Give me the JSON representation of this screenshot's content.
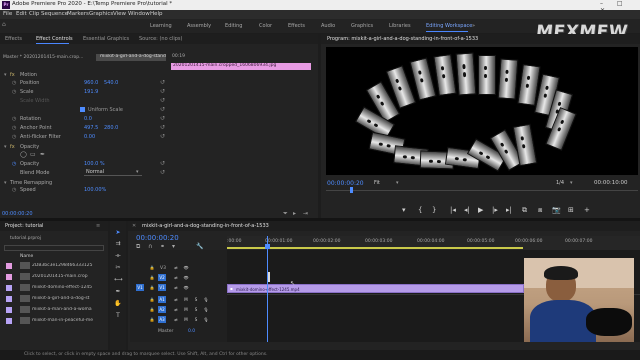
{
  "window": {
    "title": "Adobe Premiere Pro 2020 - E:\\Temp Premiere Pro\\tutorial *",
    "app_icon": "Pr",
    "controls": "–  □  ✕"
  },
  "menu": [
    "File",
    "Edit",
    "Clip",
    "Sequence",
    "Markers",
    "Graphics",
    "View",
    "Window",
    "Help"
  ],
  "workspaces": {
    "items": [
      "Learning",
      "Assembly",
      "Editing",
      "Color",
      "Effects",
      "Audio",
      "Graphics",
      "Libraries",
      "Editing Workspace"
    ],
    "active_index": 8,
    "more": "»"
  },
  "watermark": "MEXMEW",
  "left_tabs": [
    "Effects",
    "Effect Controls",
    "Essential Graphics",
    "Source: (no clips)"
  ],
  "left_tabs_active": 1,
  "effect_controls": {
    "master_label": "Master * 20201201415-main.crop...",
    "clip_label": "mixkit-a-girl-and-a-dog-standi...",
    "timecode_ruler": "00:19",
    "clip_bar": "20201201415-main.cropped_1606806934.jpg",
    "motion": "Motion",
    "position_label": "Position",
    "position_x": "960.0",
    "position_y": "540.0",
    "scale_label": "Scale",
    "scale_value": "191.9",
    "scale_width_label": "Scale Width",
    "uniform_scale": "Uniform Scale",
    "rotation_label": "Rotation",
    "rotation_value": "0.0",
    "anchor_label": "Anchor Point",
    "anchor_x": "497.5",
    "anchor_y": "280.0",
    "antiflicker_label": "Anti-flicker Filter",
    "antiflicker_value": "0.00",
    "opacity": "Opacity",
    "opacity_label": "Opacity",
    "opacity_value": "100.0 %",
    "blend_label": "Blend Mode",
    "blend_value": "Normal",
    "time_remap": "Time Remapping",
    "speed_label": "Speed",
    "speed_value": "100.00%",
    "bottom_timecode": "00:00:00:20"
  },
  "program": {
    "tab": "Program: mixkit-a-girl-and-a-dog-standing-in-front-of-a-1533",
    "timecode": "00:00:00:20",
    "fit": "Fit",
    "resolution": "1/4",
    "duration": "00:00:10:00",
    "controls": [
      "▾",
      "{",
      "}",
      "|◂",
      "◂|",
      "▶",
      "|▸",
      "▸|",
      "⧉",
      "⧈",
      "📷",
      "⊞",
      "+"
    ]
  },
  "project": {
    "tab": "Project: tutorial",
    "file": "tutorial.prproj",
    "name_header": "Name",
    "items": [
      {
        "name": "2DB3bc3e1298466333125",
        "color": "#e39be0"
      },
      {
        "name": "20201201415-main.crop",
        "color": "#e39be0"
      },
      {
        "name": "mixkit-domino-effect-1245",
        "color": "#b7a3f5"
      },
      {
        "name": "mixkit-a-girl-and-a-dog-st",
        "color": "#b7a3f5"
      },
      {
        "name": "mixkit-a-man-and-a-woma",
        "color": "#b7a3f5"
      },
      {
        "name": "mixkit-man-in-peaceful-me",
        "color": "#b7a3f5"
      }
    ]
  },
  "timeline": {
    "tab": "mixkit-a-girl-and-a-dog-standing-in-front-of-a-1533",
    "timecode": "00:00:00:20",
    "ruler": [
      ":00:00",
      "00:00:01:00",
      "00:00:02:00",
      "00:00:03:00",
      "00:00:04:00",
      "00:00:05:00",
      "00:00:06:00",
      "00:00:07:00"
    ],
    "video_tracks": [
      "V3",
      "V2",
      "V1"
    ],
    "audio_tracks": [
      "A1",
      "A2",
      "A3"
    ],
    "master": "Master",
    "master_value": "0.0",
    "clip_name": "mixkit-domino-effect-1245.mp4",
    "track_buttons": [
      "M",
      "S"
    ]
  },
  "status": "Click to select, or click in empty space and drag to marquee select. Use Shift, Alt, and Ctrl for other options."
}
